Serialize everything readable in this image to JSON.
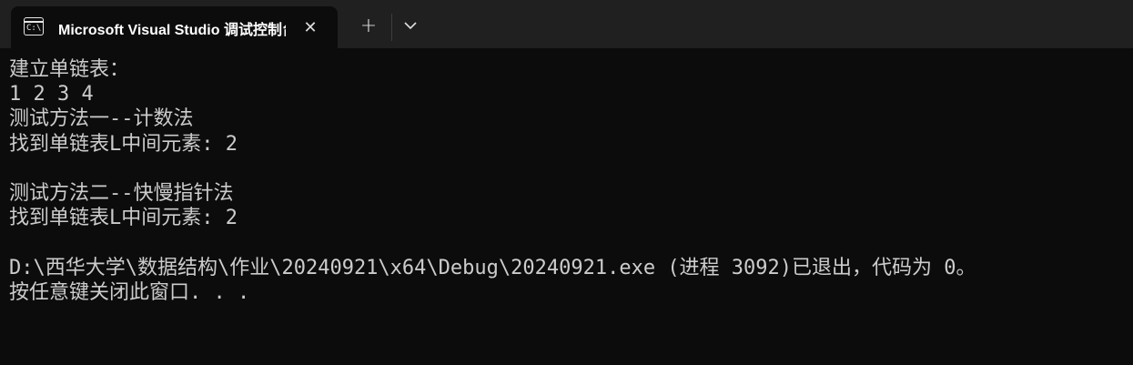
{
  "window": {
    "tab": {
      "icon": "console-icon",
      "icon_text": "C:\\",
      "title": "Microsoft Visual Studio 调试控制台",
      "close_icon": "close-icon"
    },
    "new_tab_icon": "plus-icon",
    "dropdown_icon": "chevron-down-icon"
  },
  "console": {
    "lines": [
      "建立单链表：",
      "1 2 3 4",
      "测试方法一--计数法",
      "找到单链表L中间元素: 2",
      "",
      "测试方法二--快慢指针法",
      "找到单链表L中间元素: 2",
      "",
      "D:\\西华大学\\数据结构\\作业\\20240921\\x64\\Debug\\20240921.exe (进程 3092)已退出，代码为 0。",
      "按任意键关闭此窗口. . ."
    ]
  },
  "colors": {
    "titlebar": "#202020",
    "tab_background": "#0c0c0c",
    "console_background": "#0c0c0c",
    "console_text": "#cccccc"
  }
}
